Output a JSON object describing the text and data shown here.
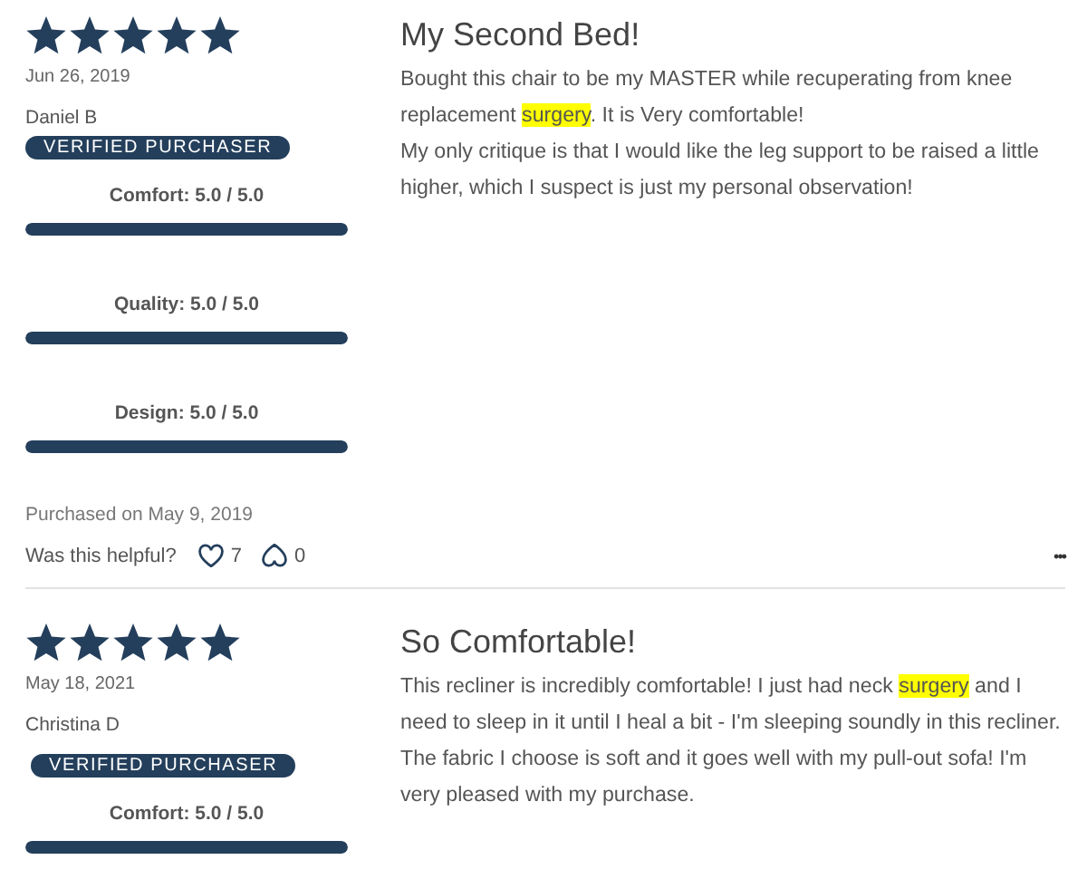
{
  "reviews": [
    {
      "stars": 5,
      "date": "Jun 26, 2019",
      "author": "Daniel B",
      "badge": "VERIFIED PURCHASER",
      "badge_inline": true,
      "ratings": [
        {
          "label": "Comfort: 5.0 / 5.0",
          "level": 1
        },
        {
          "label": "Quality: 5.0 / 5.0",
          "level": 1
        },
        {
          "label": "Design: 5.0 / 5.0",
          "level": 1
        }
      ],
      "title": "My Second Bed!",
      "paragraphs": [
        [
          {
            "text": "Bought this chair to be my MASTER while recuperating from knee replacement ",
            "highlighted": false
          },
          {
            "text": "surgery",
            "highlighted": true
          },
          {
            "text": ". It is Very comfortable!",
            "highlighted": false
          }
        ],
        [
          {
            "text": "My only critique is that I would like the leg support to be raised a little higher, which I suspect is just my personal observation!",
            "highlighted": false
          }
        ]
      ],
      "purchased": "Purchased on May 9, 2019",
      "helpful_label": "Was this helpful?",
      "likes": "7",
      "dislikes": "0",
      "more": "•••"
    },
    {
      "stars": 5,
      "date": "May 18, 2021",
      "author": "Christina D",
      "badge": "VERIFIED PURCHASER",
      "badge_inline": false,
      "ratings": [
        {
          "label": "Comfort: 5.0 / 5.0",
          "level": 1
        }
      ],
      "title": "So Comfortable!",
      "paragraphs": [
        [
          {
            "text": "This recliner is incredibly comfortable! I just had neck ",
            "highlighted": false
          },
          {
            "text": "surgery",
            "highlighted": true
          },
          {
            "text": " and I need to sleep in it until I heal a bit - I'm sleeping soundly in this recliner. The fabric I choose is soft and it goes well with my pull-out sofa! I'm very pleased with my purchase.",
            "highlighted": false
          }
        ]
      ]
    }
  ]
}
